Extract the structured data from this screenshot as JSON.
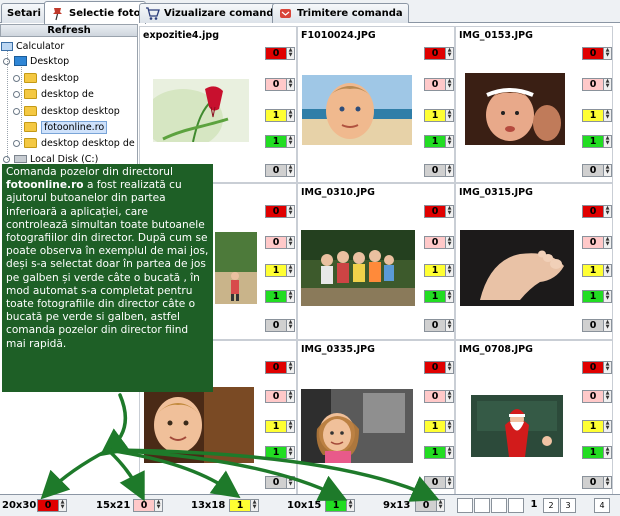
{
  "tabs": [
    {
      "label": "Setari"
    },
    {
      "label": "Selectie foto"
    },
    {
      "label": "Vizualizare comanda"
    },
    {
      "label": "Trimitere comanda"
    }
  ],
  "tree": {
    "refresh_label": "Refresh",
    "items": [
      {
        "label": "Calculator"
      },
      {
        "label": "Desktop"
      },
      {
        "label": "desktop"
      },
      {
        "label": "desktop de"
      },
      {
        "label": "desktop desktop"
      },
      {
        "label": "fotoonline.ro"
      },
      {
        "label": "desktop desktop de"
      },
      {
        "label": "Local Disk (C:)"
      }
    ]
  },
  "photos": [
    {
      "name": "expozitie4.jpg",
      "counts": [
        "0",
        "0",
        "1",
        "1",
        "0"
      ]
    },
    {
      "name": "F1010024.JPG",
      "counts": [
        "0",
        "0",
        "1",
        "1",
        "0"
      ]
    },
    {
      "name": "IMG_0153.JPG",
      "counts": [
        "0",
        "0",
        "1",
        "1",
        "0"
      ]
    },
    {
      "name": "",
      "counts": [
        "0",
        "0",
        "1",
        "1",
        "0"
      ]
    },
    {
      "name": "IMG_0310.JPG",
      "counts": [
        "0",
        "0",
        "1",
        "1",
        "0"
      ]
    },
    {
      "name": "IMG_0315.JPG",
      "counts": [
        "0",
        "0",
        "1",
        "1",
        "0"
      ]
    },
    {
      "name": "",
      "counts": [
        "0",
        "0",
        "1",
        "1",
        "0"
      ]
    },
    {
      "name": "IMG_0335.JPG",
      "counts": [
        "0",
        "0",
        "1",
        "1",
        "0"
      ]
    },
    {
      "name": "IMG_0708.JPG",
      "counts": [
        "0",
        "0",
        "1",
        "1",
        "0"
      ]
    }
  ],
  "bottom": {
    "formats": [
      {
        "label": "20x30",
        "value": "0"
      },
      {
        "label": "15x21",
        "value": "0"
      },
      {
        "label": "13x18",
        "value": "1"
      },
      {
        "label": "10x15",
        "value": "1"
      },
      {
        "label": "9x13",
        "value": "0"
      }
    ],
    "current_page": "1",
    "pages": [
      "2",
      "3",
      "4"
    ]
  },
  "note": {
    "line1": "Comanda pozelor din directorul",
    "brand": "fotoonline.ro",
    "rest": " a fost realizată cu ajutorul butoanelor din partea inferioară a aplicației, care controlează simultan toate butoanele fotografiilor din director. După cum se poate observa în exemplul de mai jos, deși s-a selectat doar în partea de jos pe galben și verde câte o bucată , în mod automat s-a completat pentru toate fotografiile din director câte o bucată pe verde si galben, astfel comanda pozelor din director fiind mai rapidă."
  },
  "colors": {
    "red": "#e00000",
    "pink": "#ffc9c9",
    "yellow": "#ffff33",
    "green": "#22dd22",
    "gray": "#d0d0d0",
    "note_bg": "#1e5f26"
  }
}
